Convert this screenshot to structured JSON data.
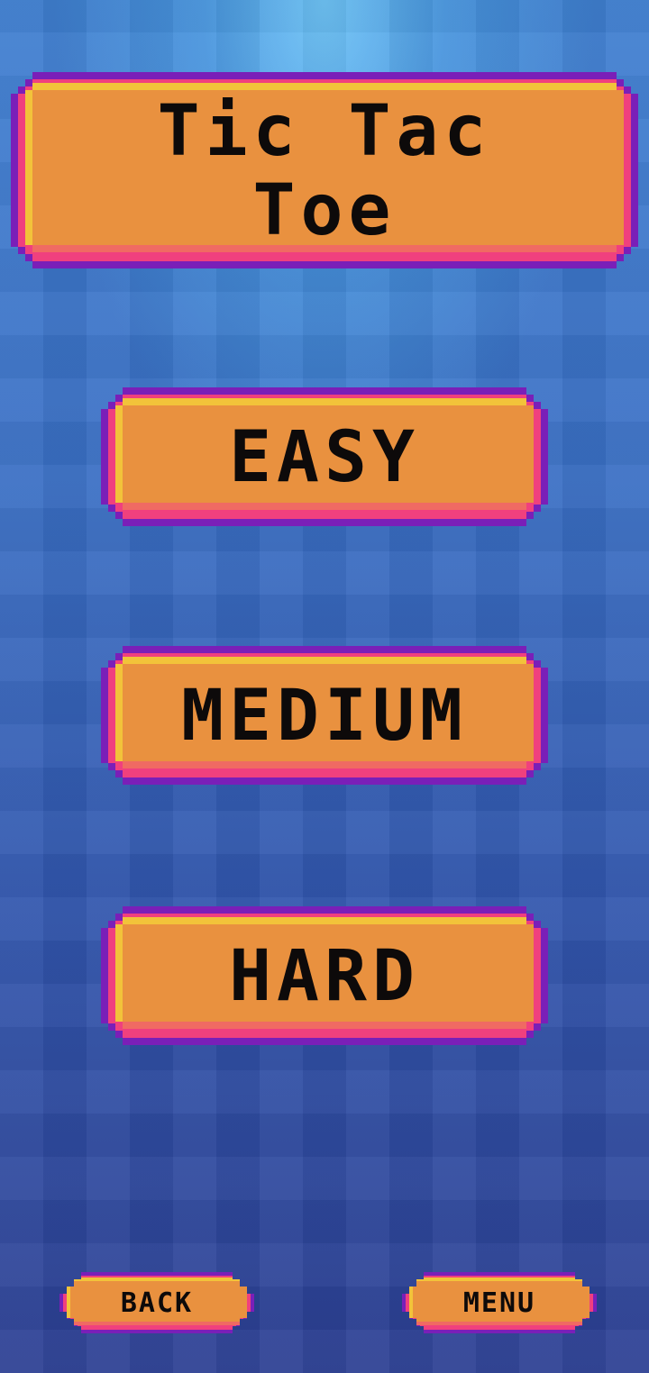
{
  "title": {
    "line1": "Tic Tac",
    "line2": "Toe"
  },
  "difficulty": {
    "easy_label": "EASY",
    "medium_label": "MEDIUM",
    "hard_label": "HARD"
  },
  "footer": {
    "back_label": "BACK",
    "menu_label": "MENU"
  },
  "colors": {
    "button_face": "#e9913f",
    "button_highlight": "#f2c33a",
    "button_pink_border": "#f0407e",
    "button_purple_outline": "#7a1fb8",
    "background_top": "#6fc6f2",
    "background_bottom": "#2c3f93"
  }
}
